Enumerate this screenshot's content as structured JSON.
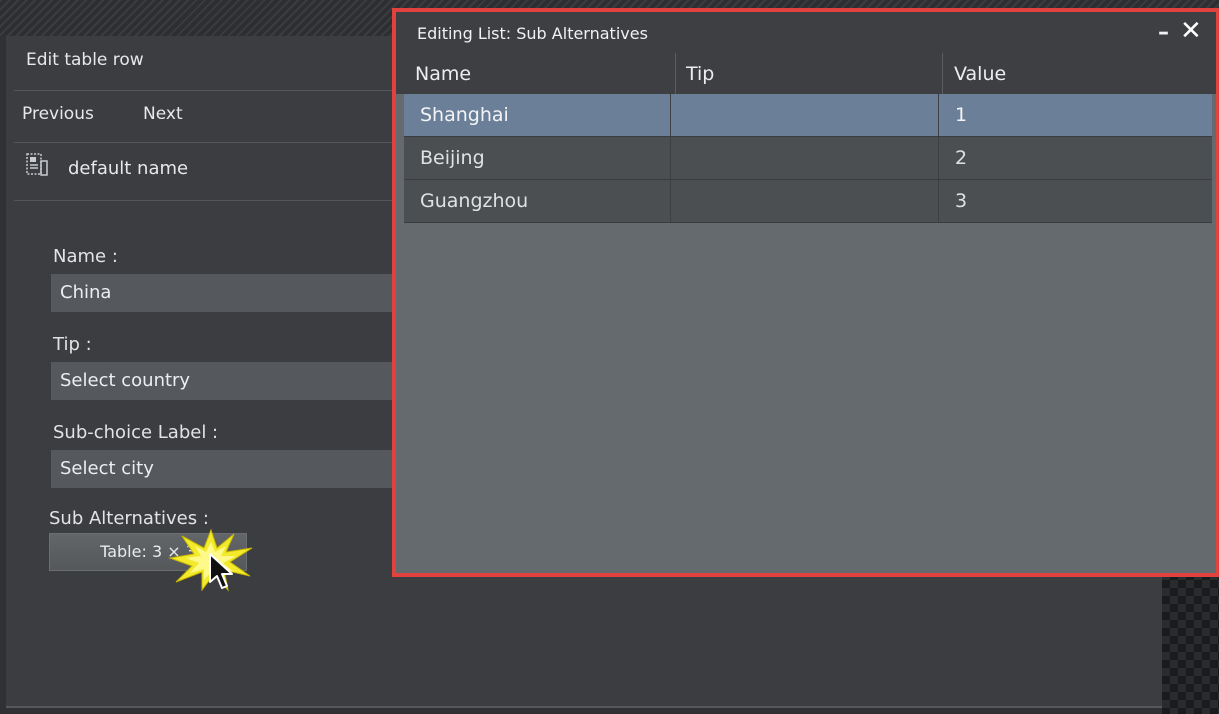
{
  "edit_panel": {
    "title": "Edit table row",
    "nav": {
      "previous": "Previous",
      "next": "Next"
    },
    "node_name": "default name",
    "fields": {
      "name_label": "Name :",
      "name_value": "China",
      "tip_label": "Tip :",
      "tip_value": "Select country",
      "subchoice_label": "Sub-choice Label :",
      "subchoice_value": "Select city",
      "subalt_label": "Sub Alternatives :",
      "subalt_button": "Table: 3 × 3"
    }
  },
  "dialog": {
    "title": "Editing List: Sub Alternatives",
    "minimize": "–",
    "close": "✕",
    "columns": [
      "Name",
      "Tip",
      "Value"
    ],
    "rows": [
      {
        "name": "Shanghai",
        "tip": "",
        "value": "1",
        "selected": true
      },
      {
        "name": "Beijing",
        "tip": "",
        "value": "2",
        "selected": false
      },
      {
        "name": "Guangzhou",
        "tip": "",
        "value": "3",
        "selected": false
      }
    ]
  },
  "colors": {
    "highlight_border": "#e1423d",
    "selected_row": "#6b8098",
    "panel_bg": "#3b3d40"
  }
}
